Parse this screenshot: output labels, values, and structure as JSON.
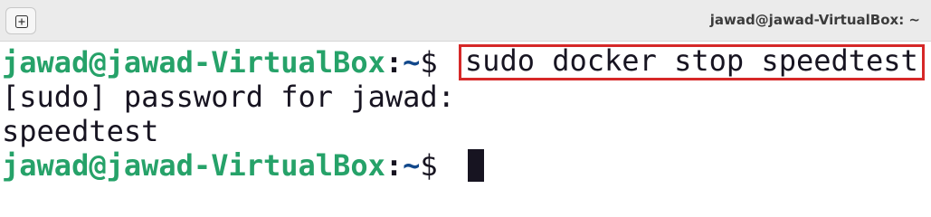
{
  "window": {
    "title": "jawad@jawad-VirtualBox: ~",
    "new_tab_icon": "new-tab-icon"
  },
  "terminal": {
    "prompt1": {
      "user_host": "jawad@jawad-VirtualBox",
      "sep": ":",
      "path": "~",
      "dollar": "$ ",
      "command": "sudo docker stop speedtest"
    },
    "output_lines": [
      "[sudo] password for jawad:",
      "speedtest"
    ],
    "prompt2": {
      "user_host": "jawad@jawad-VirtualBox",
      "sep": ":",
      "path": "~",
      "dollar": "$ "
    }
  },
  "colors": {
    "prompt_user": "#26a269",
    "prompt_path": "#12488b",
    "highlight_box": "#d62828",
    "text": "#171421"
  }
}
